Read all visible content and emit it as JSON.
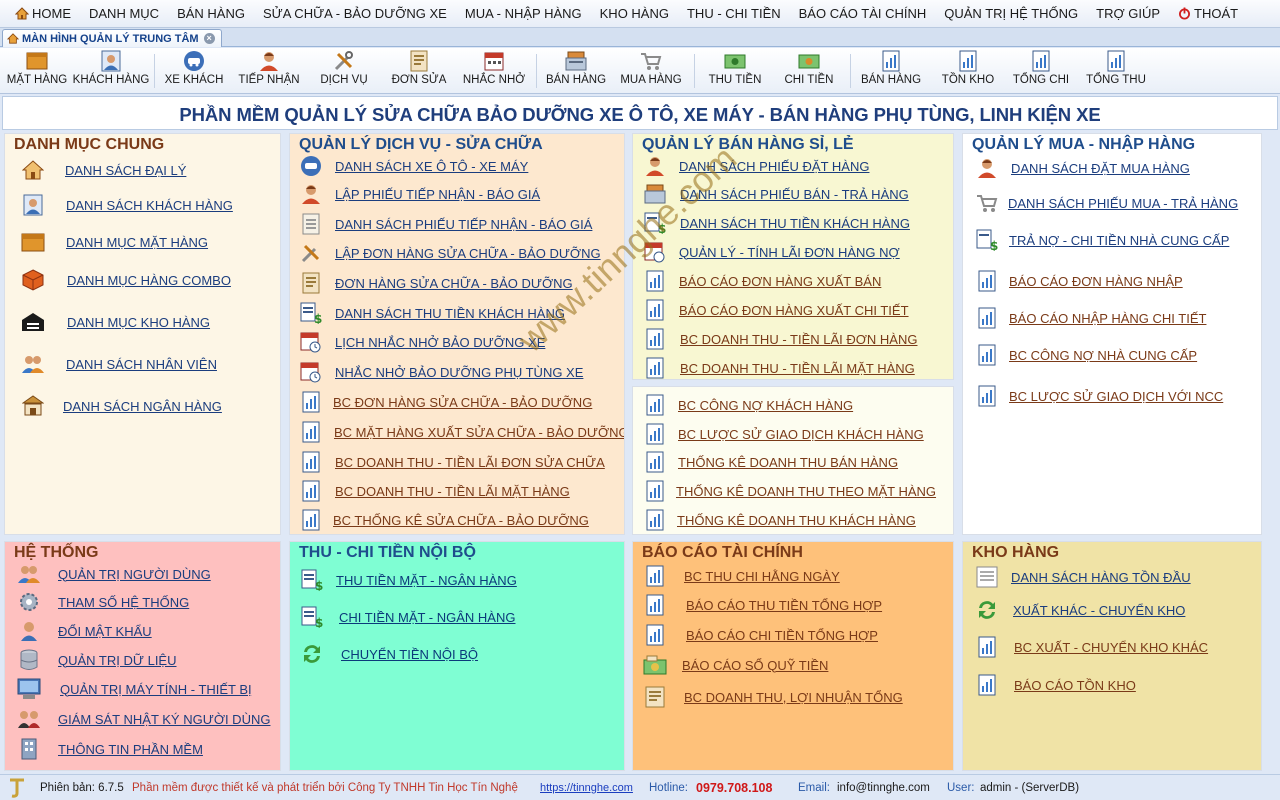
{
  "menu": {
    "items": [
      "HOME",
      "DANH MỤC",
      "BÁN HÀNG",
      "SỬA CHỮA - BẢO DƯỠNG XE",
      "MUA - NHẬP HÀNG",
      "KHO HÀNG",
      "THU - CHI TIỀN",
      "BÁO CÁO TÀI CHÍNH",
      "QUẢN TRỊ HỆ THỐNG",
      "TRỢ GIÚP",
      "THOÁT"
    ]
  },
  "tab": {
    "label": "MÀN HÌNH QUẢN LÝ TRUNG TÂM"
  },
  "toolbar": {
    "buttons": [
      "MẶT HÀNG",
      "KHÁCH HÀNG",
      "XE KHÁCH",
      "TIẾP NHẬN",
      "DỊCH VỤ",
      "ĐƠN SỬA",
      "NHẮC NHỞ",
      "BÁN HÀNG",
      "MUA HÀNG",
      "THU TIỀN",
      "CHI TIỀN",
      "BÁN HÀNG",
      "TỒN KHO",
      "TỔNG CHI",
      "TỔNG THU"
    ]
  },
  "banner": {
    "title": "PHẦN MỀM QUẢN LÝ SỬA CHỮA BẢO DƯỠNG XE Ô TÔ, XE MÁY - BÁN HÀNG PHỤ TÙNG, LINH KIỆN XE"
  },
  "panels": {
    "danh_muc": {
      "title": "DANH MỤC CHUNG",
      "items": [
        "DANH SÁCH ĐẠI LÝ",
        "DANH SÁCH KHÁCH HÀNG",
        "DANH MỤC MẶT HÀNG",
        "DANH MỤC HÀNG COMBO",
        "DANH MỤC KHO HÀNG",
        "DANH SÁCH NHÂN VIÊN",
        "DANH SÁCH NGÂN HÀNG"
      ]
    },
    "dich_vu": {
      "title": "QUẢN LÝ DỊCH VỤ -  SỬA CHỮA",
      "items": [
        "DANH SÁCH XE Ô TÔ - XE MÁY",
        "LẬP PHIẾU TIẾP NHẬN - BÁO GIÁ",
        "DANH SÁCH PHIẾU TIẾP NHẬN - BÁO GIÁ",
        "LẬP ĐƠN HÀNG SỬA CHỮA - BẢO DƯỠNG",
        "ĐƠN HÀNG SỬA CHỮA - BẢO DƯỠNG",
        "DANH SÁCH THU TIỀN KHÁCH HÀNG",
        "LỊCH NHẮC NHỞ BẢO DƯỠNG XE",
        "NHẮC NHỞ BẢO DƯỠNG PHỤ TÙNG XE",
        "BC ĐƠN HÀNG SỬA CHỮA - BẢO DƯỠNG",
        "BC MẶT HÀNG XUẤT SỬA CHỮA - BẢO DƯỠNG",
        "BC DOANH THU - TIỀN LÃI ĐƠN SỬA CHỮA",
        "BC DOANH THU - TIỀN LÃI MẶT HÀNG",
        "BC THỐNG KÊ SỬA CHỮA - BẢO DƯỠNG"
      ]
    },
    "ban_hang": {
      "title": "QUẢN LÝ BÁN HÀNG SỈ, LẺ",
      "items": [
        "DANH SÁCH PHIẾU ĐẶT HÀNG",
        "DANH SÁCH PHIẾU BÁN - TRẢ HÀNG",
        "DANH SÁCH THU TIỀN KHÁCH HÀNG",
        "QUẢN LÝ - TÍNH LÃI ĐƠN HÀNG NỢ",
        "BÁO CÁO ĐƠN HÀNG XUẤT BÁN",
        "BÁO CÁO ĐƠN HÀNG XUẤT CHI TIẾT",
        "BC DOANH THU - TIỀN LÃI ĐƠN HÀNG",
        "BC DOANH THU - TIỀN LÃI MẶT HÀNG"
      ],
      "items2": [
        "BC CÔNG NỢ KHÁCH HÀNG",
        "BC LƯỢC SỬ GIAO DỊCH KHÁCH HÀNG",
        "THỐNG KÊ DOANH THU BÁN HÀNG",
        "THỐNG KÊ DOANH THU THEO MẶT HÀNG",
        "THỐNG KÊ DOANH THU KHÁCH HÀNG"
      ]
    },
    "mua_hang": {
      "title": "QUẢN LÝ MUA - NHẬP HÀNG",
      "items": [
        "DANH SÁCH ĐẶT MUA HÀNG",
        "DANH SÁCH PHIẾU MUA - TRẢ HÀNG",
        "TRẢ NỢ - CHI TIỀN NHÀ CUNG CẤP",
        "BÁO CÁO ĐƠN HÀNG NHẬP",
        "BÁO CÁO NHẬP HÀNG CHI TIẾT",
        "BC CÔNG NỢ NHÀ CUNG CẤP",
        "BC LƯỢC SỬ GIAO DỊCH VỚI NCC"
      ]
    },
    "he_thong": {
      "title": "HỆ THỐNG",
      "items": [
        "QUẢN TRỊ NGƯỜI DÙNG",
        "THAM SỐ HỆ THỐNG",
        "ĐỔI MẬT KHẨU",
        "QUẢN TRỊ DỮ LIỆU",
        "QUẢN TRỊ MÁY TÍNH - THIẾT BỊ",
        "GIÁM SÁT NHẬT KÝ NGƯỜI DÙNG",
        "THÔNG TIN PHẦN MỀM"
      ]
    },
    "thu_chi": {
      "title": "THU - CHI TIỀN NỘI BỘ",
      "items": [
        "THU TIỀN MẶT - NGÂN HÀNG",
        "CHI TIỀN MẶT - NGÂN HÀNG",
        "CHUYỂN TIỀN NỘI BỘ"
      ]
    },
    "tai_chinh": {
      "title": "BÁO CÁO TÀI CHÍNH",
      "items": [
        "BC THU CHI HẰNG NGÀY",
        "BÁO CÁO THU TIỀN TỔNG HỢP",
        "BÁO CÁO CHI TIỀN TỔNG HỢP",
        "BÁO CÁO SỔ QUỸ TIỀN",
        "BC DOANH THU, LỢI NHUẬN TỔNG"
      ]
    },
    "kho_hang": {
      "title": "KHO HÀNG",
      "items": [
        "DANH SÁCH HÀNG TỒN ĐẦU",
        "XUẤT KHÁC - CHUYỂN KHO",
        "BC XUẤT - CHUYỂN KHO KHÁC",
        "BÁO CÁO TỒN KHO"
      ]
    }
  },
  "status": {
    "version": "Phiên bản: 6.7.5",
    "credit": "Phần mềm được thiết kế và phát triển bởi Công Ty TNHH Tin Học Tín Nghệ",
    "link": "https://tinnghe.com",
    "hotline_label": "Hotline:",
    "hotline": "0979.708.108",
    "email_label": "Email:",
    "email": "info@tinnghe.com",
    "user_label": "User:",
    "user": "admin -  (ServerDB)"
  },
  "watermark": "www.tinnghe.com"
}
